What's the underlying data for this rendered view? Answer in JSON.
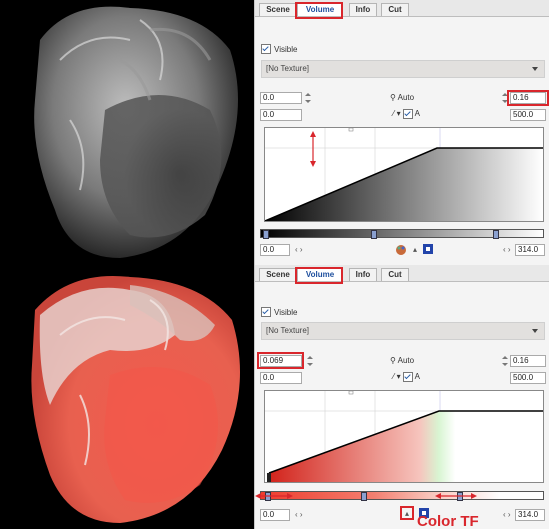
{
  "colors": {
    "accent": "#d9262c",
    "tab_active": "#1e4f9e",
    "tf_red": "#ef3b2c"
  },
  "top_panel": {
    "tabs": [
      {
        "label": "Scene"
      },
      {
        "label": "Volume"
      },
      {
        "label": "Info"
      },
      {
        "label": "Cut"
      }
    ],
    "active_tab": "Volume",
    "visible_label": "Visible",
    "texture": "[No Texture]",
    "lower_value": "0.0",
    "upper_value": "0.16",
    "auto_label": "Auto",
    "min_value": "0.0",
    "a_label": "A",
    "max_value": "500.0",
    "range_min": "0.0",
    "range_max": "314.0"
  },
  "bottom_panel": {
    "tabs": [
      {
        "label": "Scene"
      },
      {
        "label": "Volume"
      },
      {
        "label": "Info"
      },
      {
        "label": "Cut"
      }
    ],
    "active_tab": "Volume",
    "visible_label": "Visible",
    "texture": "[No Texture]",
    "lower_value": "0.069",
    "upper_value": "0.16",
    "auto_label": "Auto",
    "min_value": "0.0",
    "a_label": "A",
    "max_value": "500.0",
    "range_min": "0.0",
    "range_max": "314.0"
  },
  "annotation": {
    "color_tf": "Color TF"
  }
}
